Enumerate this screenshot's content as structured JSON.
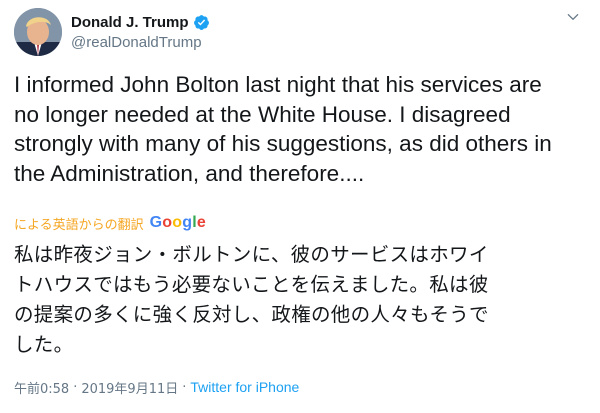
{
  "author": {
    "display_name": "Donald J. Trump",
    "handle": "@realDonaldTrump",
    "verified_icon": "verified-badge-icon",
    "verified_color": "#1da1f2"
  },
  "tweet": {
    "text": "I informed John Bolton last night that his services are\nno longer needed at the White House. I disagreed\nstrongly with many of his suggestions, as did others in\nthe Administration, and therefore...."
  },
  "translation": {
    "label": "による英語からの翻訳",
    "provider_letters": [
      "G",
      "o",
      "o",
      "g",
      "l",
      "e"
    ],
    "provider_colors": [
      "#4285f4",
      "#ea4335",
      "#fbbc05",
      "#4285f4",
      "#34a853",
      "#ea4335"
    ],
    "text": "私は昨夜ジョン・ボルトンに、彼のサービスはホワイ\nトハウスではもう必要ないことを伝えました。私は彼\nの提案の多くに強く反対し、政権の他の人々もそうで\nした。"
  },
  "meta": {
    "time": "午前0:58",
    "separator": "·",
    "date": "2019年9月11日",
    "source": "Twitter for iPhone",
    "source_color": "#1da1f2"
  },
  "icons": {
    "menu": "chevron-down-icon"
  }
}
